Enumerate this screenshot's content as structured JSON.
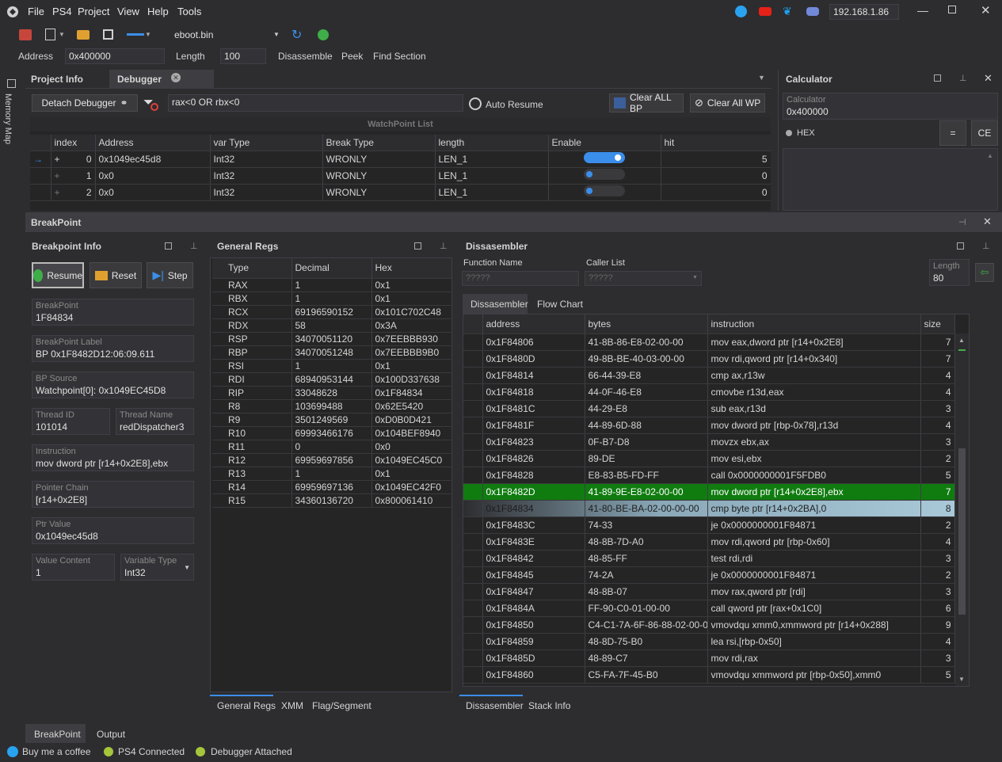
{
  "menu": [
    "File",
    "PS4",
    "Project",
    "View",
    "Help",
    "Tools"
  ],
  "ip": "192.168.1.86",
  "toolbar": {
    "file": "eboot.bin"
  },
  "addr": {
    "address_label": "Address",
    "address_value": "0x400000",
    "length_label": "Length",
    "length_value": "100",
    "disassemble": "Disassemble",
    "peek": "Peek",
    "find_section": "Find Section"
  },
  "side": {
    "memory_map": "Memory Map"
  },
  "tabs": {
    "project_info": "Project Info",
    "debugger": "Debugger"
  },
  "debugger": {
    "detach": "Detach Debugger",
    "filter": "rax<0 OR rbx<0",
    "auto_resume": "Auto Resume",
    "clear_bp": "Clear ALL BP",
    "clear_wp": "Clear All WP",
    "watch_title": "WatchPoint List",
    "cols": [
      "index",
      "Address",
      "var Type",
      "Break Type",
      "length",
      "Enable",
      "hit"
    ],
    "rows": [
      {
        "idx": "0",
        "addr": "0x1049ec45d8",
        "type": "Int32",
        "break": "WRONLY",
        "len": "LEN_1",
        "on": true,
        "hit": "5"
      },
      {
        "idx": "1",
        "addr": "0x0",
        "type": "Int32",
        "break": "WRONLY",
        "len": "LEN_1",
        "on": false,
        "hit": "0"
      },
      {
        "idx": "2",
        "addr": "0x0",
        "type": "Int32",
        "break": "WRONLY",
        "len": "LEN_1",
        "on": false,
        "hit": "0"
      }
    ]
  },
  "calc": {
    "title": "Calculator",
    "label": "Calculator",
    "value": "0x400000",
    "hex": "HEX",
    "eq": "=",
    "ce": "CE"
  },
  "bp": {
    "title": "BreakPoint",
    "info_title": "Breakpoint Info",
    "resume": "Resume",
    "reset": "Reset",
    "step": "Step",
    "fields": {
      "breakpoint_l": "BreakPoint",
      "breakpoint_v": "1F84834",
      "label_l": "BreakPoint Label",
      "label_v": "BP 0x1F8482D12:06:09.611",
      "source_l": "BP Source",
      "source_v": "Watchpoint[0]: 0x1049EC45D8",
      "tid_l": "Thread ID",
      "tid_v": "101014",
      "tname_l": "Thread Name",
      "tname_v": "redDispatcher3",
      "instr_l": "Instruction",
      "instr_v": "mov  dword ptr [r14+0x2E8],ebx",
      "chain_l": "Pointer Chain",
      "chain_v": "[r14+0x2E8]",
      "ptr_l": "Ptr Value",
      "ptr_v": "0x1049ec45d8",
      "vc_l": "Value Content",
      "vc_v": "1",
      "vt_l": "Variable Type",
      "vt_v": "Int32"
    }
  },
  "regs": {
    "title": "General Regs",
    "cols": [
      "Type",
      "Decimal",
      "Hex"
    ],
    "rows": [
      [
        "RAX",
        "1",
        "0x1"
      ],
      [
        "RBX",
        "1",
        "0x1"
      ],
      [
        "RCX",
        "69196590152",
        "0x101C702C48"
      ],
      [
        "RDX",
        "58",
        "0x3A"
      ],
      [
        "RSP",
        "34070051120",
        "0x7EEBBB930"
      ],
      [
        "RBP",
        "34070051248",
        "0x7EEBBB9B0"
      ],
      [
        "RSI",
        "1",
        "0x1"
      ],
      [
        "RDI",
        "68940953144",
        "0x100D337638"
      ],
      [
        "RIP",
        "33048628",
        "0x1F84834"
      ],
      [
        "R8",
        "103699488",
        "0x62E5420"
      ],
      [
        "R9",
        "3501249569",
        "0xD0B0D421"
      ],
      [
        "R10",
        "69993466176",
        "0x104BEF8940"
      ],
      [
        "R11",
        "0",
        "0x0"
      ],
      [
        "R12",
        "69959697856",
        "0x1049EC45C0"
      ],
      [
        "R13",
        "1",
        "0x1"
      ],
      [
        "R14",
        "69959697136",
        "0x1049EC42F0"
      ],
      [
        "R15",
        "34360136720",
        "0x800061410"
      ]
    ],
    "tabs": [
      "General Regs",
      "XMM",
      "Flag/Segment"
    ]
  },
  "dis": {
    "title": "Dissasembler",
    "fn_label": "Function Name",
    "fn_ph": "?????",
    "caller_label": "Caller List",
    "caller_ph": "?????",
    "len_label": "Length",
    "len_value": "80",
    "tabs": [
      "Dissasembler",
      "Flow Chart"
    ],
    "cols": [
      "address",
      "bytes",
      "instruction",
      "size"
    ],
    "rows": [
      [
        "0x1F84806",
        "41-8B-86-E8-02-00-00",
        "mov  eax,dword ptr [r14+0x2E8]",
        "7"
      ],
      [
        "0x1F8480D",
        "49-8B-BE-40-03-00-00",
        "mov  rdi,qword ptr [r14+0x340]",
        "7"
      ],
      [
        "0x1F84814",
        "66-44-39-E8",
        "cmp  ax,r13w",
        "4"
      ],
      [
        "0x1F84818",
        "44-0F-46-E8",
        "cmovbe r13d,eax",
        "4"
      ],
      [
        "0x1F8481C",
        "44-29-E8",
        "sub  eax,r13d",
        "3"
      ],
      [
        "0x1F8481F",
        "44-89-6D-88",
        "mov  dword ptr [rbp-0x78],r13d",
        "4"
      ],
      [
        "0x1F84823",
        "0F-B7-D8",
        "movzx ebx,ax",
        "3"
      ],
      [
        "0x1F84826",
        "89-DE",
        "mov  esi,ebx",
        "2"
      ],
      [
        "0x1F84828",
        "E8-83-B5-FD-FF",
        "call 0x0000000001F5FDB0",
        "5"
      ],
      [
        "0x1F8482D",
        "41-89-9E-E8-02-00-00",
        "mov  dword ptr [r14+0x2E8],ebx",
        "7"
      ],
      [
        "0x1F84834",
        "41-80-BE-BA-02-00-00-00",
        "cmp  byte ptr [r14+0x2BA],0",
        "8"
      ],
      [
        "0x1F8483C",
        "74-33",
        "je   0x0000000001F84871",
        "2"
      ],
      [
        "0x1F8483E",
        "48-8B-7D-A0",
        "mov  rdi,qword ptr [rbp-0x60]",
        "4"
      ],
      [
        "0x1F84842",
        "48-85-FF",
        "test rdi,rdi",
        "3"
      ],
      [
        "0x1F84845",
        "74-2A",
        "je   0x0000000001F84871",
        "2"
      ],
      [
        "0x1F84847",
        "48-8B-07",
        "mov  rax,qword ptr [rdi]",
        "3"
      ],
      [
        "0x1F8484A",
        "FF-90-C0-01-00-00",
        "call qword ptr [rax+0x1C0]",
        "6"
      ],
      [
        "0x1F84850",
        "C4-C1-7A-6F-86-88-02-00-00",
        "vmovdqu xmm0,xmmword ptr [r14+0x288]",
        "9"
      ],
      [
        "0x1F84859",
        "48-8D-75-B0",
        "lea  rsi,[rbp-0x50]",
        "4"
      ],
      [
        "0x1F8485D",
        "48-89-C7",
        "mov  rdi,rax",
        "3"
      ],
      [
        "0x1F84860",
        "C5-FA-7F-45-B0",
        "vmovdqu xmmword ptr [rbp-0x50],xmm0",
        "5"
      ]
    ],
    "bottom_tabs": [
      "Dissasembler",
      "Stack Info"
    ]
  },
  "bottom_tabs": [
    "BreakPoint",
    "Output"
  ],
  "status": {
    "coffee": "Buy me a coffee",
    "ps4": "PS4 Connected",
    "dbg": "Debugger Attached"
  }
}
